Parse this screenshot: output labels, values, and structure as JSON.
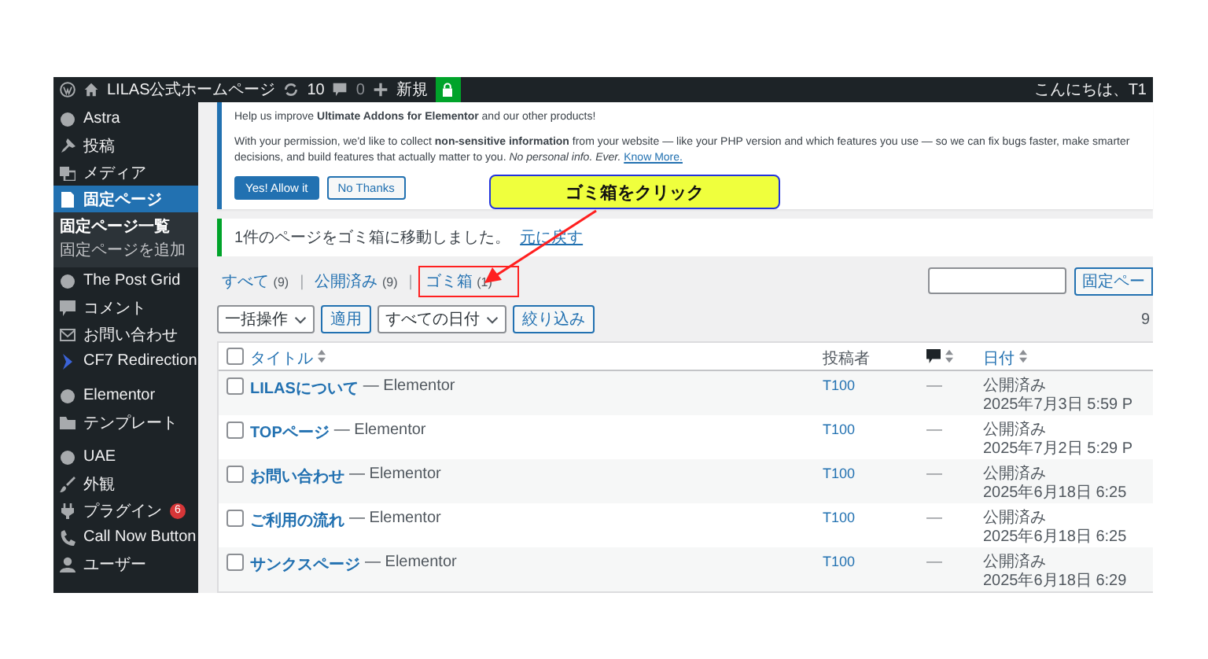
{
  "admin_bar": {
    "site_title": "LILAS公式ホームページ",
    "updates": "10",
    "comments": "0",
    "new_label": "新規",
    "greeting": "こんにちは、T1"
  },
  "sidebar": {
    "groups": [
      {
        "items": [
          {
            "label": "Astra",
            "selected": false
          },
          {
            "label": "投稿",
            "selected": false
          },
          {
            "label": "メディア",
            "selected": false
          },
          {
            "label": "固定ページ",
            "selected": true,
            "children": [
              {
                "label": "固定ページ一覧",
                "selected": true
              },
              {
                "label": "固定ページを追加",
                "selected": false
              }
            ]
          },
          {
            "label": "The Post Grid",
            "selected": false
          },
          {
            "label": "コメント",
            "selected": false
          },
          {
            "label": "お問い合わせ",
            "selected": false
          },
          {
            "label": "CF7 Redirection",
            "selected": false
          }
        ]
      },
      {
        "items": [
          {
            "label": "Elementor",
            "selected": false
          },
          {
            "label": "テンプレート",
            "selected": false
          }
        ]
      },
      {
        "items": [
          {
            "label": "UAE",
            "selected": false
          },
          {
            "label": "外観",
            "selected": false
          },
          {
            "label": "プラグイン",
            "selected": false,
            "badge": "6"
          },
          {
            "label": "Call Now Button",
            "selected": false
          },
          {
            "label": "ユーザー",
            "selected": false
          }
        ]
      }
    ]
  },
  "consent_notice": {
    "heading": "Help us improve **Ultimate Addons for Elementor** and our other products!",
    "body": "With your permission, we'd like to collect **non-sensitive information** from your website — like your PHP version and which features you use — so we can fix bugs faster, make smarter decisions, and build features that actually matter to you. *No personal info. Ever.*",
    "link": "Know More.",
    "buttons": [
      {
        "label": "Yes! Allow it",
        "kind": "primary"
      },
      {
        "label": "No Thanks",
        "kind": "secondary"
      }
    ]
  },
  "trash_notice": {
    "text": "1件のページをゴミ箱に移動しました。",
    "link": "元に戻す"
  },
  "callout": {
    "text": "ゴミ箱をクリック"
  },
  "filter_separator": "|",
  "filters": [
    {
      "label": "すべて",
      "count": "(9)",
      "selected": false,
      "highlighted": false
    },
    {
      "label": "公開済み",
      "count": "(9)",
      "selected": false,
      "highlighted": false
    },
    {
      "label": "ゴミ箱",
      "count": "(1)",
      "selected": false,
      "highlighted": true
    }
  ],
  "search": {
    "button": "固定ペー"
  },
  "toolbar": {
    "bulk_action": "一括操作",
    "apply": "適用",
    "date_filter": "すべての日付",
    "filter": "絞り込み",
    "items_count": "9"
  },
  "table": {
    "select_all_checked": false,
    "columns": [
      {
        "kind": "title",
        "label": "タイトル",
        "sortable": true
      },
      {
        "kind": "author",
        "label": "投稿者",
        "sortable": false
      },
      {
        "kind": "comments",
        "sortable": true
      },
      {
        "kind": "date",
        "label": "日付",
        "sortable": true
      }
    ],
    "rows": [
      {
        "title": "LILASについて",
        "editor": "— Elementor",
        "author": "T100",
        "comments": "—",
        "status": "公開済み",
        "date": "2025年7月3日 5:59 P",
        "checked": false
      },
      {
        "title": "TOPページ",
        "editor": "— Elementor",
        "author": "T100",
        "comments": "—",
        "status": "公開済み",
        "date": "2025年7月2日 5:29 P",
        "checked": false
      },
      {
        "title": "お問い合わせ",
        "editor": "— Elementor",
        "author": "T100",
        "comments": "—",
        "status": "公開済み",
        "date": "2025年6月18日 6:25",
        "checked": false
      },
      {
        "title": "ご利用の流れ",
        "editor": "— Elementor",
        "author": "T100",
        "comments": "—",
        "status": "公開済み",
        "date": "2025年6月18日 6:25",
        "checked": false
      },
      {
        "title": "サンクスページ",
        "editor": "— Elementor",
        "author": "T100",
        "comments": "—",
        "status": "公開済み",
        "date": "2025年6月18日 6:29",
        "checked": false
      }
    ]
  }
}
